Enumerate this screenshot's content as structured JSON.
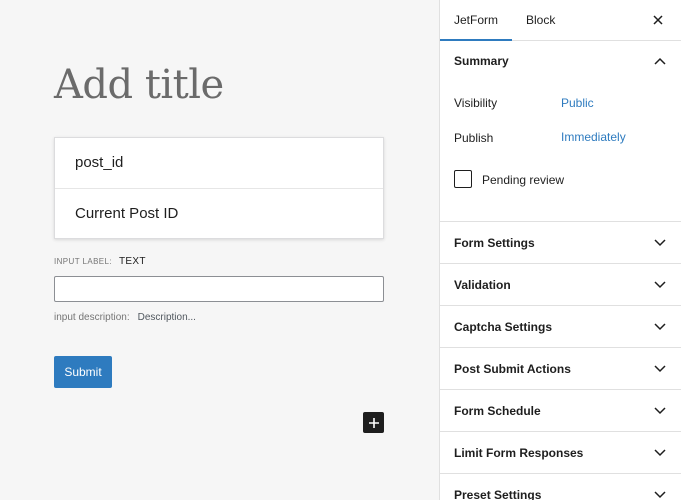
{
  "editor": {
    "title_placeholder": "Add title",
    "select_options": [
      "post_id",
      "Current Post ID"
    ],
    "input_label_caption": "INPUT LABEL:",
    "input_label_value": "TEXT",
    "input_value": "",
    "description_caption": "input description:",
    "description_placeholder": "Description...",
    "submit_label": "Submit"
  },
  "sidebar": {
    "tabs": [
      {
        "label": "JetForm",
        "active": true
      },
      {
        "label": "Block",
        "active": false
      }
    ],
    "summary": {
      "title": "Summary",
      "visibility_label": "Visibility",
      "visibility_value": "Public",
      "publish_label": "Publish",
      "publish_value": "Immediately",
      "pending_review_label": "Pending review",
      "pending_review_checked": false
    },
    "panels": [
      "Form Settings",
      "Validation",
      "Captcha Settings",
      "Post Submit Actions",
      "Form Schedule",
      "Limit Form Responses",
      "Preset Settings"
    ]
  },
  "colors": {
    "accent": "#2e7bbf",
    "text": "#1e1e1e",
    "canvas_bg": "#f6f6f6"
  },
  "icons": {
    "close": "close-icon",
    "chevron_up": "chevron-up-icon",
    "chevron_down": "chevron-down-icon",
    "plus": "plus-icon"
  }
}
